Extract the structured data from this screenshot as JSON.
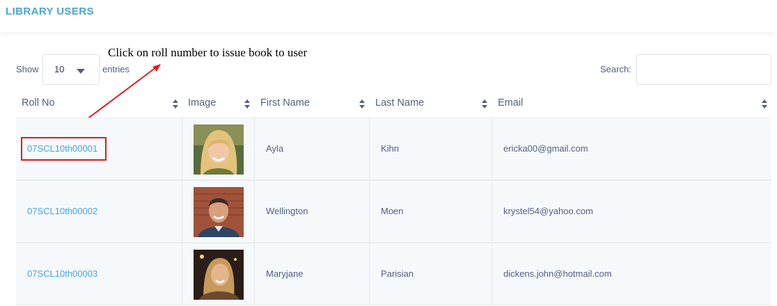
{
  "page": {
    "title": "LIBRARY USERS"
  },
  "annotation": {
    "text": "Click on roll number to issue book to user"
  },
  "controls": {
    "show_label": "Show",
    "entries_label": "entries",
    "page_length": "10",
    "search_label": "Search:",
    "search_value": ""
  },
  "table": {
    "headers": [
      "Roll No",
      "Image",
      "First Name",
      "Last Name",
      "Email"
    ],
    "rows": [
      {
        "roll_no": "07SCL10th00001",
        "first_name": "Ayla",
        "last_name": "Kihn",
        "email": "ericka00@gmail.com"
      },
      {
        "roll_no": "07SCL10th00002",
        "first_name": "Wellington",
        "last_name": "Moen",
        "email": "krystel54@yahoo.com"
      },
      {
        "roll_no": "07SCL10th00003",
        "first_name": "Maryjane",
        "last_name": "Parisian",
        "email": "dickens.john@hotmail.com"
      }
    ]
  },
  "colors": {
    "accent": "#4aa3df",
    "highlight": "#e01b1b",
    "row_bg": "#f6f9fc"
  }
}
